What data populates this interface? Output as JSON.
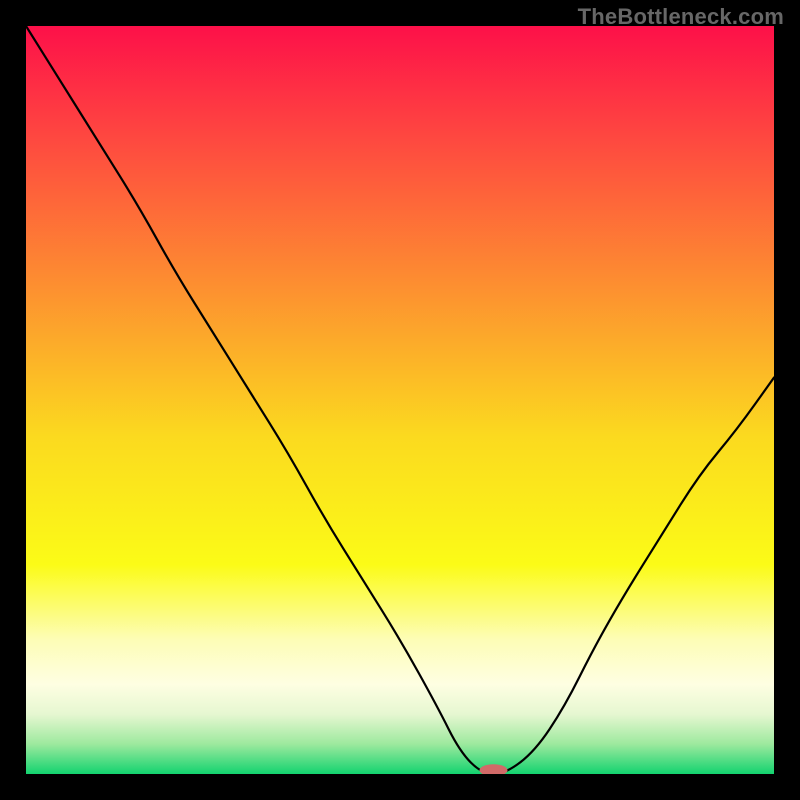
{
  "watermark": "TheBottleneck.com",
  "chart_data": {
    "type": "line",
    "title": "",
    "xlabel": "",
    "ylabel": "",
    "xlim": [
      0,
      100
    ],
    "ylim": [
      0,
      100
    ],
    "grid": false,
    "x": [
      0,
      5,
      10,
      15,
      20,
      25,
      30,
      35,
      40,
      45,
      50,
      55,
      58,
      61,
      64,
      68,
      72,
      76,
      80,
      85,
      90,
      95,
      100
    ],
    "values": [
      100,
      92,
      84,
      76,
      67,
      59,
      51,
      43,
      34,
      26,
      18,
      9,
      3,
      0,
      0,
      3,
      9,
      17,
      24,
      32,
      40,
      46,
      53
    ],
    "marker": {
      "x": 62.5,
      "y": 0.5,
      "color": "#d16a68",
      "rx": 14,
      "ry": 6
    },
    "background_gradient": {
      "type": "vertical",
      "stops": [
        {
          "offset": 0.0,
          "color": "#fd1049"
        },
        {
          "offset": 0.15,
          "color": "#fe4840"
        },
        {
          "offset": 0.35,
          "color": "#fd9030"
        },
        {
          "offset": 0.55,
          "color": "#fbda1f"
        },
        {
          "offset": 0.72,
          "color": "#fbfb17"
        },
        {
          "offset": 0.82,
          "color": "#fdfdb6"
        },
        {
          "offset": 0.88,
          "color": "#fefee2"
        },
        {
          "offset": 0.92,
          "color": "#e6f7d1"
        },
        {
          "offset": 0.96,
          "color": "#9de99e"
        },
        {
          "offset": 1.0,
          "color": "#13d36f"
        }
      ]
    },
    "curve_color": "#000000",
    "curve_width": 2.2
  }
}
